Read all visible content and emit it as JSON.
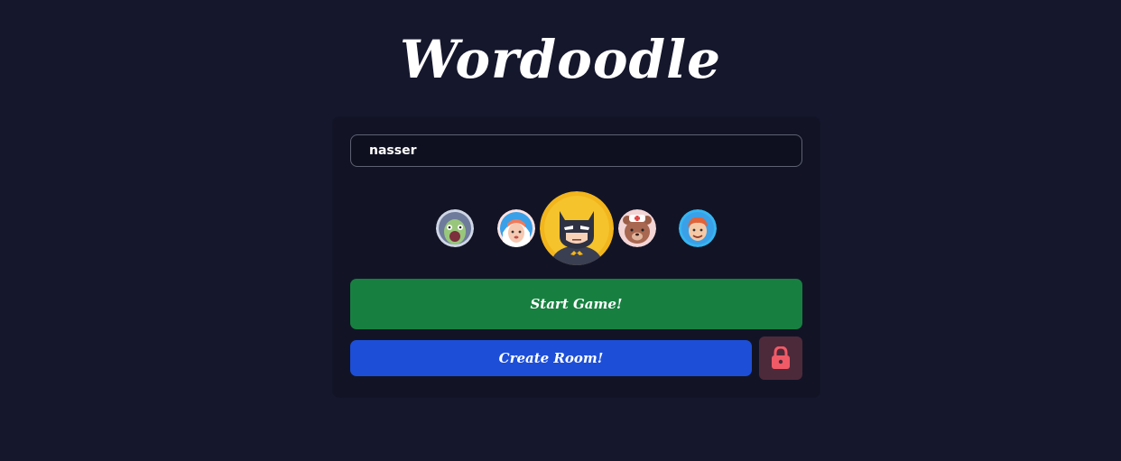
{
  "app": {
    "title": "Wordoodle"
  },
  "form": {
    "username_value": "nasser"
  },
  "avatars": [
    {
      "name": "zombie"
    },
    {
      "name": "nurse-girl"
    },
    {
      "name": "batman",
      "selected": true
    },
    {
      "name": "bear-nurse"
    },
    {
      "name": "redhead-boy"
    }
  ],
  "buttons": {
    "start_label": "Start Game!",
    "create_label": "Create Room!",
    "lock_icon": "lock-icon"
  },
  "colors": {
    "background": "#15172d",
    "card": "#121426",
    "start": "#178040",
    "create": "#1d4ed8",
    "lock_bg": "#4d2a3a",
    "lock_icon": "#f05a67",
    "selected_ring": "#f2b51c"
  }
}
